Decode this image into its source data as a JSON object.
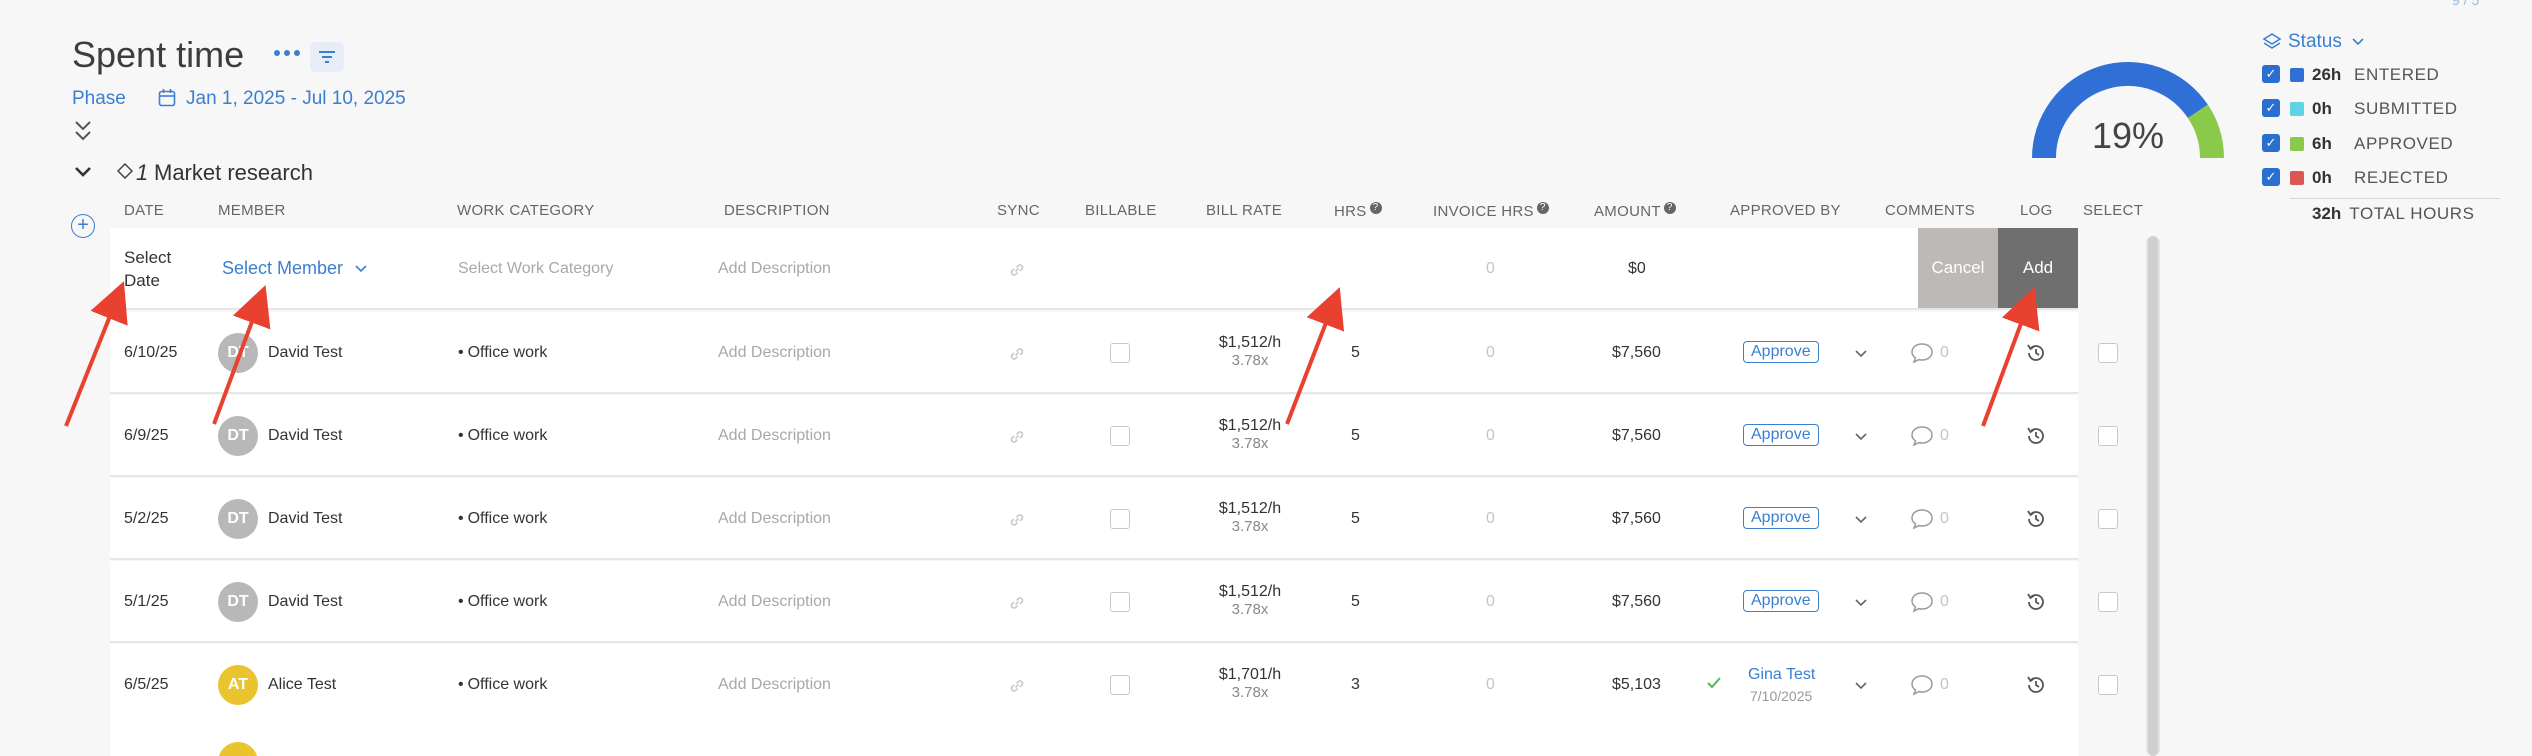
{
  "header": {
    "title": "Spent time",
    "phase_label": "Phase",
    "date_range": "Jan 1, 2025 - Jul 10, 2025",
    "top_corner": "9 / 5"
  },
  "phase": {
    "number": "1",
    "name": "Market research"
  },
  "columns": {
    "date": "DATE",
    "member": "MEMBER",
    "work_category": "WORK CATEGORY",
    "description": "DESCRIPTION",
    "sync": "SYNC",
    "billable": "BILLABLE",
    "bill_rate": "BILL RATE",
    "hrs": "HRS",
    "invoice_hrs": "INVOICE HRS",
    "amount": "AMOUNT",
    "approved_by": "APPROVED BY",
    "comments": "COMMENTS",
    "log": "LOG",
    "select": "SELECT",
    "help": "?"
  },
  "new_entry": {
    "date_placeholder_1": "Select",
    "date_placeholder_2": "Date",
    "member_placeholder": "Select Member",
    "work_category_placeholder": "Select Work Category",
    "description_placeholder": "Add Description",
    "invoice_hrs": "0",
    "amount": "$0",
    "cancel_label": "Cancel",
    "add_label": "Add"
  },
  "rows": [
    {
      "date": "6/10/25",
      "initials": "DT",
      "avatar_color": "#b8b8b8",
      "member": "David Test",
      "category": "Office work",
      "description": "Add Description",
      "rate": "$1,512/h",
      "multiplier": "3.78x",
      "hrs": "5",
      "invoice_hrs": "0",
      "amount": "$7,560",
      "approve_label": "Approve",
      "comments": "0"
    },
    {
      "date": "6/9/25",
      "initials": "DT",
      "avatar_color": "#b8b8b8",
      "member": "David Test",
      "category": "Office work",
      "description": "Add Description",
      "rate": "$1,512/h",
      "multiplier": "3.78x",
      "hrs": "5",
      "invoice_hrs": "0",
      "amount": "$7,560",
      "approve_label": "Approve",
      "comments": "0"
    },
    {
      "date": "5/2/25",
      "initials": "DT",
      "avatar_color": "#b8b8b8",
      "member": "David Test",
      "category": "Office work",
      "description": "Add Description",
      "rate": "$1,512/h",
      "multiplier": "3.78x",
      "hrs": "5",
      "invoice_hrs": "0",
      "amount": "$7,560",
      "approve_label": "Approve",
      "comments": "0"
    },
    {
      "date": "5/1/25",
      "initials": "DT",
      "avatar_color": "#b8b8b8",
      "member": "David Test",
      "category": "Office work",
      "description": "Add Description",
      "rate": "$1,512/h",
      "multiplier": "3.78x",
      "hrs": "5",
      "invoice_hrs": "0",
      "amount": "$7,560",
      "approve_label": "Approve",
      "comments": "0"
    },
    {
      "date": "6/5/25",
      "initials": "AT",
      "avatar_color": "#e9c42e",
      "member": "Alice Test",
      "category": "Office work",
      "description": "Add Description",
      "rate": "$1,701/h",
      "multiplier": "3.78x",
      "hrs": "3",
      "invoice_hrs": "0",
      "amount": "$5,103",
      "approver": "Gina Test",
      "approved_date": "7/10/2025",
      "comments": "0"
    }
  ],
  "status_panel": {
    "header": "Status",
    "percent": "19%",
    "items": [
      {
        "hours": "26h",
        "label": "ENTERED",
        "color": "#2f6fd6",
        "checked": true,
        "fraction": 0.8125
      },
      {
        "hours": "0h",
        "label": "SUBMITTED",
        "color": "#5fd3e3",
        "checked": true,
        "fraction": 0
      },
      {
        "hours": "6h",
        "label": "APPROVED",
        "color": "#8bc94a",
        "checked": true,
        "fraction": 0.1875
      },
      {
        "hours": "0h",
        "label": "REJECTED",
        "color": "#dd5555",
        "checked": true,
        "fraction": 0
      }
    ],
    "total_hours": "32h",
    "total_label": "TOTAL HOURS"
  },
  "colors": {
    "accent": "#3a7fd0",
    "annotation_arrow": "#e8412f"
  }
}
